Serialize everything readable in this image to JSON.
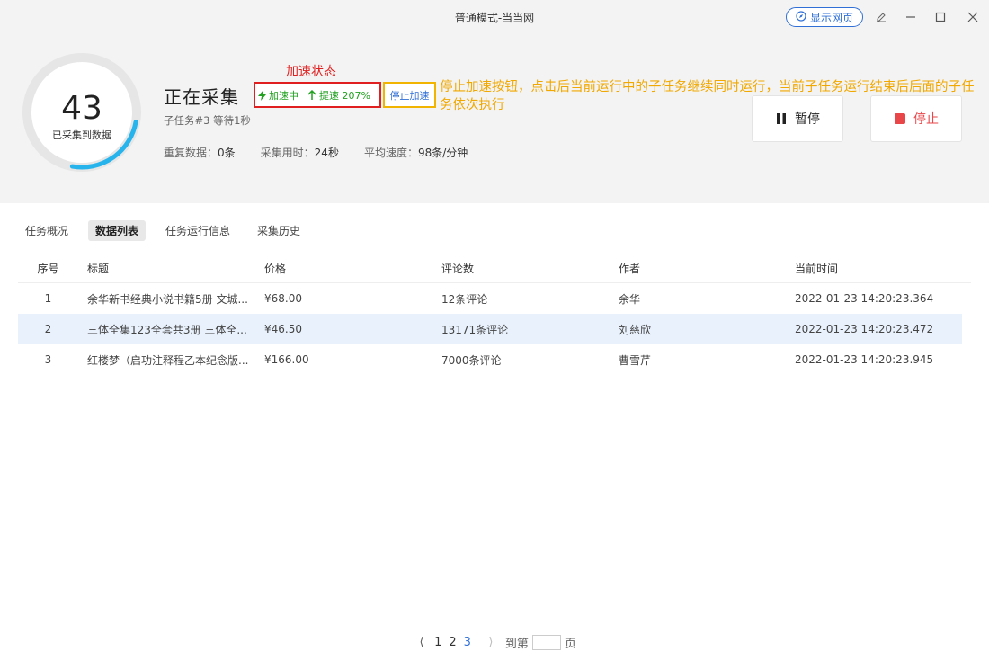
{
  "titlebar": {
    "title": "普通模式-当当网",
    "show_web_label": "显示网页"
  },
  "progress": {
    "count": "43",
    "caption": "已采集到数据",
    "ring_fraction": 0.25
  },
  "status": {
    "title": "正在采集",
    "accelerating_label": "加速中",
    "speedup_label": "提速 207%",
    "stop_accel_label": "停止加速",
    "sub_line": "子任务#3 等待1秒",
    "stats": [
      {
        "label": "重复数据：",
        "value": "0条"
      },
      {
        "label": "采集用时：",
        "value": "24秒"
      },
      {
        "label": "平均速度：",
        "value": "98条/分钟"
      }
    ]
  },
  "annotations": {
    "speed_state": "加速状态",
    "stop_accel_note": "停止加速按钮，点击后当前运行中的子任务继续同时运行，当前子任务运行结束后后面的子任务依次执行"
  },
  "controls": {
    "pause_label": "暂停",
    "stop_label": "停止"
  },
  "tabs": [
    {
      "label": "任务概况"
    },
    {
      "label": "数据列表",
      "active": true
    },
    {
      "label": "任务运行信息"
    },
    {
      "label": "采集历史"
    }
  ],
  "table": {
    "headers": [
      "序号",
      "标题",
      "价格",
      "评论数",
      "作者",
      "当前时间"
    ],
    "rows": [
      [
        "1",
        "余华新书经典小说书籍5册 文城...",
        "¥68.00",
        "12条评论",
        "余华",
        "2022-01-23 14:20:23.364"
      ],
      [
        "2",
        "三体全集123全套共3册 三体全...",
        "¥46.50",
        "13171条评论",
        "刘慈欣",
        "2022-01-23 14:20:23.472"
      ],
      [
        "3",
        "红楼梦（启功注释程乙本纪念版...",
        "¥166.00",
        "7000条评论",
        "曹雪芹",
        "2022-01-23 14:20:23.945"
      ]
    ]
  },
  "pager": {
    "pages": [
      "1",
      "2",
      "3"
    ],
    "current": "3",
    "goto_prefix": "到第",
    "goto_suffix": "页"
  },
  "colors": {
    "accent": "#2f6fd6",
    "accel_green": "#22a020",
    "stop_red": "#e9464a",
    "annotation_red": "#e02020",
    "annotation_yellow": "#f1a800"
  }
}
